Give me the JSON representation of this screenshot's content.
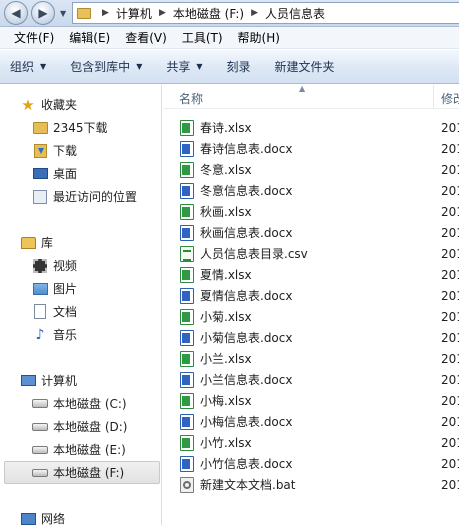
{
  "address_bar": {
    "crumbs": [
      "计算机",
      "本地磁盘 (F:)",
      "人员信息表"
    ]
  },
  "menu": [
    "文件(F)",
    "编辑(E)",
    "查看(V)",
    "工具(T)",
    "帮助(H)"
  ],
  "toolbar": {
    "organize": "组织",
    "include_in_library": "包含到库中",
    "share": "共享",
    "burn": "刻录",
    "new_folder": "新建文件夹"
  },
  "nav": {
    "favorites": "收藏夹",
    "favorites_items": [
      "2345下载",
      "下载",
      "桌面",
      "最近访问的位置"
    ],
    "libraries": "库",
    "library_items": [
      "视频",
      "图片",
      "文档",
      "音乐"
    ],
    "computer": "计算机",
    "drives": [
      "本地磁盘 (C:)",
      "本地磁盘 (D:)",
      "本地磁盘 (E:)",
      "本地磁盘 (F:)"
    ],
    "network": "网络"
  },
  "columns": {
    "name": "名称",
    "modified": "修改"
  },
  "files": [
    {
      "name": "春诗.xlsx",
      "type": "xlsx",
      "date": "201"
    },
    {
      "name": "春诗信息表.docx",
      "type": "docx",
      "date": "201"
    },
    {
      "name": "冬意.xlsx",
      "type": "xlsx",
      "date": "201"
    },
    {
      "name": "冬意信息表.docx",
      "type": "docx",
      "date": "201"
    },
    {
      "name": "秋画.xlsx",
      "type": "xlsx",
      "date": "201"
    },
    {
      "name": "秋画信息表.docx",
      "type": "docx",
      "date": "201"
    },
    {
      "name": "人员信息表目录.csv",
      "type": "csv",
      "date": "201"
    },
    {
      "name": "夏情.xlsx",
      "type": "xlsx",
      "date": "201"
    },
    {
      "name": "夏情信息表.docx",
      "type": "docx",
      "date": "201"
    },
    {
      "name": "小菊.xlsx",
      "type": "xlsx",
      "date": "201"
    },
    {
      "name": "小菊信息表.docx",
      "type": "docx",
      "date": "201"
    },
    {
      "name": "小兰.xlsx",
      "type": "xlsx",
      "date": "201"
    },
    {
      "name": "小兰信息表.docx",
      "type": "docx",
      "date": "201"
    },
    {
      "name": "小梅.xlsx",
      "type": "xlsx",
      "date": "201"
    },
    {
      "name": "小梅信息表.docx",
      "type": "docx",
      "date": "201"
    },
    {
      "name": "小竹.xlsx",
      "type": "xlsx",
      "date": "201"
    },
    {
      "name": "小竹信息表.docx",
      "type": "docx",
      "date": "201"
    },
    {
      "name": "新建文本文档.bat",
      "type": "bat",
      "date": "201"
    }
  ]
}
